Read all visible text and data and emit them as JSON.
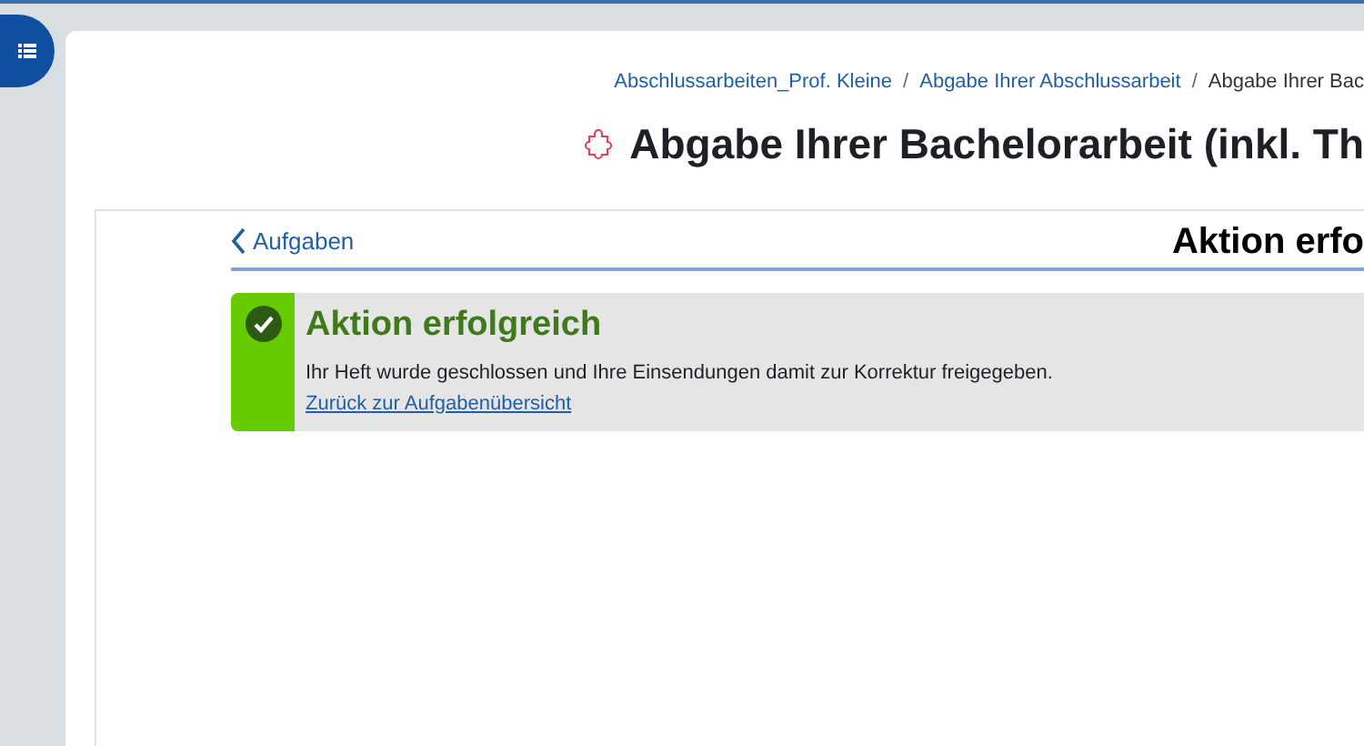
{
  "sidebar_toggle": {
    "expanded": false
  },
  "breadcrumb": [
    {
      "label": "Abschlussarbeiten_Prof. Kleine",
      "link": true
    },
    {
      "separator": "/",
      "label": "Abgabe Ihrer Abschlussarbeit",
      "link": true
    },
    {
      "separator": "/",
      "label": "Abgabe Ihrer Bac",
      "link": false
    }
  ],
  "page_title": "Abgabe Ihrer Bachelorarbeit (inkl. Th",
  "back_link": "Aufgaben",
  "section_heading": "Aktion erfo",
  "alert": {
    "kind": "success",
    "title": "Aktion erfolgreich",
    "message": "Ihr Heft wurde geschlossen und Ihre Einsendungen damit zur Korrektur freigegeben.",
    "link": "Zurück zur Aufgabenübersicht"
  }
}
